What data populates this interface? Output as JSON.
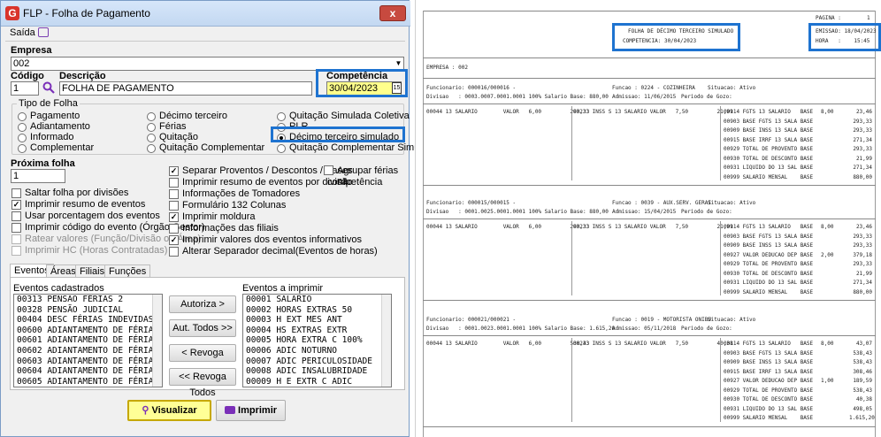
{
  "window": {
    "title": "FLP - Folha de Pagamento",
    "logo": "G",
    "close": "x"
  },
  "menu": {
    "saida": "Saída"
  },
  "empresa": {
    "label": "Empresa",
    "value": "002"
  },
  "codigo": {
    "label": "Código",
    "value": "1"
  },
  "descricao": {
    "label": "Descrição",
    "value": "FOLHA DE PAGAMENTO"
  },
  "competencia": {
    "label": "Competência",
    "value": "30/04/2023",
    "cal": "15"
  },
  "tipo_folha": {
    "label": "Tipo de Folha",
    "options": [
      {
        "label": "Pagamento",
        "checked": false
      },
      {
        "label": "Adiantamento",
        "checked": false
      },
      {
        "label": "Informado",
        "checked": false
      },
      {
        "label": "Complementar",
        "checked": false
      },
      {
        "label": "Décimo terceiro",
        "checked": false
      },
      {
        "label": "Férias",
        "checked": false
      },
      {
        "label": "Quitação",
        "checked": false
      },
      {
        "label": "Quitação Complementar",
        "checked": false
      },
      {
        "label": "Quitação Simulada Coletiva",
        "checked": false
      },
      {
        "label": "PLR",
        "checked": false
      },
      {
        "label": "Décimo terceiro simulado",
        "checked": true
      },
      {
        "label": "Quitação Complementar Simulada",
        "checked": false
      }
    ]
  },
  "proxima_folha": {
    "label": "Próxima folha",
    "value": "1"
  },
  "left_checks": [
    {
      "label": "Saltar folha por divisões",
      "checked": false,
      "disabled": false
    },
    {
      "label": "Imprimir resumo de eventos",
      "checked": true,
      "disabled": false
    },
    {
      "label": "Usar porcentagem dos eventos",
      "checked": false,
      "disabled": false
    },
    {
      "label": "Imprimir código do evento (Órgão Gestor)",
      "checked": false,
      "disabled": false
    },
    {
      "label": "Ratear valores (Função/Divisão ou Área)",
      "checked": false,
      "disabled": true
    },
    {
      "label": "Imprimir HC (Horas Contratadas)",
      "checked": false,
      "disabled": true
    }
  ],
  "right_checks": [
    {
      "label": "Separar Proventos / Descontos / Bases",
      "checked": true
    },
    {
      "label": "Imprimir resumo de eventos por divisão",
      "checked": false
    },
    {
      "label": "Informações de Tomadores",
      "checked": false
    },
    {
      "label": "Formulário 132 Colunas",
      "checked": false
    },
    {
      "label": "Imprimir moldura",
      "checked": true
    },
    {
      "label": "Informações das filiais",
      "checked": false
    },
    {
      "label": "Imprimir valores dos eventos informativos",
      "checked": true
    },
    {
      "label": "Alterar Separador decimal(Eventos de horas)",
      "checked": false
    }
  ],
  "agrupar": {
    "label1": "Agrupar férias na",
    "label2": "competência",
    "checked": false
  },
  "tabs": [
    "Eventos",
    "Áreas",
    "Filiais",
    "Funções"
  ],
  "eventos_cadastrados": {
    "label": "Eventos cadastrados",
    "items": [
      "00313 PENSAO FÉRIAS 2",
      "00328 PENSÃO JUDICIAL",
      "00404 DESC FÉRIAS INDEVIDAS",
      "00600 ADIANTAMENTO DE FÉRIA",
      "00601 ADIANTAMENTO DE FÉRIA",
      "00602 ADIANTAMENTO DE FÉRIA",
      "00603 ADIANTAMENTO DE FÉRIA",
      "00604 ADIANTAMENTO DE FÉRIA",
      "00605 ADIANTAMENTO DE FÉRIA"
    ]
  },
  "eventos_imprimir": {
    "label": "Eventos a imprimir",
    "items": [
      "00001 SALARIO",
      "00002 HORAS EXTRAS 50",
      "00003 H EXT MES ANT",
      "00004 HS EXTRAS EXTR",
      "00005 HORA EXTRA C 100%",
      "00006 ADIC NOTURNO",
      "00007 ADIC PERICULOSIDADE",
      "00008 ADIC INSALUBRIDADE",
      "00009 H E EXTR C ADIC"
    ]
  },
  "mid_buttons": [
    "Autoriza >",
    "Aut. Todos >>",
    "< Revoga",
    "<< Revoga Todos"
  ],
  "footer": {
    "visualizar": "Visualizar",
    "imprimir": "Imprimir"
  },
  "report": {
    "pagina_label": "PAGINA :",
    "pagina_value": "1",
    "title": "FOLHA DE DÉCIMO TERCEIRO SIMULADO",
    "competencia": "COMPETENCIA: 30/04/2023",
    "emissao": "EMISSAO: 18/04/2023",
    "hora": "HORA   :    15:45",
    "empresa": "EMPRESA : 002",
    "blocks": [
      {
        "func": "Funcionario: 000016/000016 -",
        "funcao": "Funcao : 0224 - COZINHEIRA",
        "situacao": "Situacao: Ativo",
        "divisao": "Divisao   : 0003.0007.0001.0001 100% Salario Base: 880,00",
        "admissao": "Admissao: 11/06/2015",
        "periodo": "Periodo de Gozo:",
        "provento": "00044 13 SALARIO        VALOR   6,00         293,33",
        "desconto": "00233 INSS S 13 SALARIO VALOR   7,50         21,99",
        "bases": [
          [
            "00114 FGTS 13 SALARIO   BASE",
            "8,00",
            "23,46"
          ],
          [
            "00903 BASE FGTS 13 SALA BASE",
            "",
            "293,33"
          ],
          [
            "00909 BASE INSS 13 SALA BASE",
            "",
            "293,33"
          ],
          [
            "00915 BASE IRRF 13 SALA BASE",
            "",
            "271,34"
          ],
          [
            "00929 TOTAL DE PROVENTO BASE",
            "",
            "293,33"
          ],
          [
            "00930 TOTAL DE DESCONTO BASE",
            "",
            "21,99"
          ],
          [
            "00931 LIQUIDO DO 13 SAL BASE",
            "",
            "271,34"
          ],
          [
            "00999 SALARIO MENSAL    BASE",
            "",
            "880,00"
          ]
        ]
      },
      {
        "func": "Funcionario: 000015/000015 -",
        "funcao": "Funcao : 0039 - AUX.SERV. GERAI",
        "situacao": "Situacao: Ativo",
        "divisao": "Divisao   : 0001.0025.0001.0001 100% Salario Base: 880,00",
        "admissao": "Admissao: 15/04/2015",
        "periodo": "Periodo de Gozo:",
        "provento": "00044 13 SALARIO        VALOR   6,00         293,33",
        "desconto": "00233 INSS S 13 SALARIO VALOR   7,50         21,99",
        "bases": [
          [
            "00114 FGTS 13 SALARIO   BASE",
            "8,00",
            "23,46"
          ],
          [
            "00903 BASE FGTS 13 SALA BASE",
            "",
            "293,33"
          ],
          [
            "00909 BASE INSS 13 SALA BASE",
            "",
            "293,33"
          ],
          [
            "00927 VALOR DEDUCAO DEP BASE",
            "2,00",
            "379,18"
          ],
          [
            "00929 TOTAL DE PROVENTO BASE",
            "",
            "293,33"
          ],
          [
            "00930 TOTAL DE DESCONTO BASE",
            "",
            "21,99"
          ],
          [
            "00931 LIQUIDO DO 13 SAL BASE",
            "",
            "271,34"
          ],
          [
            "00999 SALARIO MENSAL    BASE",
            "",
            "880,00"
          ]
        ]
      },
      {
        "func": "Funcionario: 000021/000021 -",
        "funcao": "Funcao : 0019 - MOTORISTA ONIBU",
        "situacao": "Situacao: Ativo",
        "divisao": "Divisao   : 0001.0023.0001.0001 100% Salario Base: 1.615,20",
        "admissao": "Admissao: 05/11/2018",
        "periodo": "Periodo de Gozo:",
        "provento": "00044 13 SALARIO        VALOR   6,00         538,43",
        "desconto": "00233 INSS S 13 SALARIO VALOR   7,50         40,38",
        "bases": [
          [
            "00114 FGTS 13 SALARIO   BASE",
            "8,00",
            "43,07"
          ],
          [
            "00903 BASE FGTS 13 SALA BASE",
            "",
            "538,43"
          ],
          [
            "00909 BASE INSS 13 SALA BASE",
            "",
            "538,43"
          ],
          [
            "00915 BASE IRRF 13 SALA BASE",
            "",
            "308,46"
          ],
          [
            "00927 VALOR DEDUCAO DEP BASE",
            "1,00",
            "189,59"
          ],
          [
            "00929 TOTAL DE PROVENTO BASE",
            "",
            "538,43"
          ],
          [
            "00930 TOTAL DE DESCONTO BASE",
            "",
            "40,38"
          ],
          [
            "00931 LIQUIDO DO 13 SAL BASE",
            "",
            "498,05"
          ],
          [
            "00999 SALARIO MENSAL    BASE",
            "",
            "1.615,20"
          ]
        ]
      }
    ]
  }
}
